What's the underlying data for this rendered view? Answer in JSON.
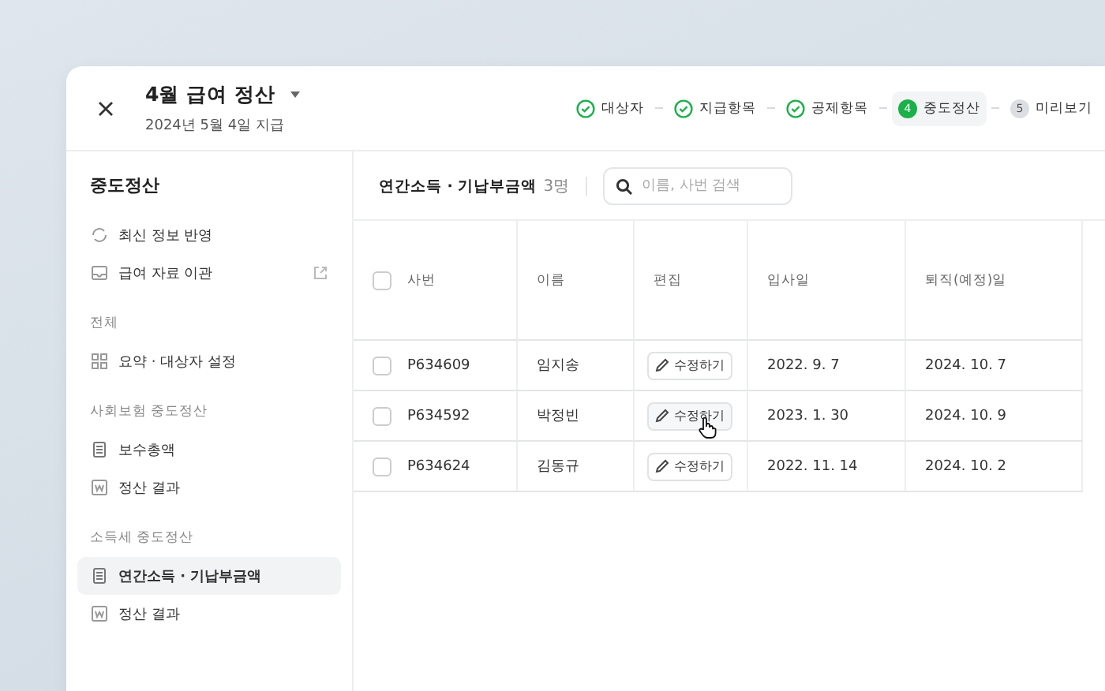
{
  "header": {
    "title": "4월 급여 정산",
    "subtitle": "2024년 5월 4일 지급"
  },
  "steps": [
    {
      "label": "대상자",
      "done": true,
      "selected": false
    },
    {
      "label": "지급항목",
      "done": true,
      "selected": false
    },
    {
      "label": "공제항목",
      "done": true,
      "selected": false
    },
    {
      "label": "중도정산",
      "done": false,
      "selected": true,
      "number": "4"
    },
    {
      "label": "미리보기",
      "done": false,
      "selected": false,
      "number": "5"
    }
  ],
  "sidebar": {
    "title": "중도정산",
    "sections": [
      {
        "items": [
          {
            "label": "최신 정보 반영",
            "kind": "refresh",
            "selected": false,
            "external": false
          },
          {
            "label": "급여 자료 이관",
            "kind": "inbox",
            "selected": false,
            "external": true
          }
        ]
      },
      {
        "heading": "전체",
        "items": [
          {
            "label": "요약 · 대상자 설정",
            "kind": "grid",
            "selected": false,
            "external": false
          }
        ]
      },
      {
        "heading": "사회보험 중도정산",
        "items": [
          {
            "label": "보수총액",
            "kind": "doc",
            "selected": false,
            "external": false
          },
          {
            "label": "정산 결과",
            "kind": "w",
            "selected": false,
            "external": false
          }
        ]
      },
      {
        "heading": "소득세 중도정산",
        "items": [
          {
            "label": "연간소득 · 기납부금액",
            "kind": "doc",
            "selected": true,
            "external": false
          },
          {
            "label": "정산 결과",
            "kind": "w",
            "selected": false,
            "external": false
          }
        ]
      }
    ]
  },
  "content": {
    "title": "연간소득 · 기납부금액",
    "count": "3명",
    "search": {
      "placeholder": "이름, 사번 검색"
    }
  },
  "table": {
    "all_checked": false,
    "columns": [
      "사번",
      "이름",
      "편집",
      "입사일",
      "퇴직(예정)일"
    ],
    "rows": [
      {
        "checked": false,
        "id": "P634609",
        "name": "임지송",
        "edit": "수정하기",
        "hovered": false,
        "joined": "2022. 9. 7",
        "left": "2024. 10. 7"
      },
      {
        "checked": false,
        "id": "P634592",
        "name": "박정빈",
        "edit": "수정하기",
        "hovered": true,
        "joined": "2023. 1. 30",
        "left": "2024. 10. 9"
      },
      {
        "checked": false,
        "id": "P634624",
        "name": "김동규",
        "edit": "수정하기",
        "hovered": false,
        "joined": "2022. 11. 14",
        "left": "2024. 10. 2"
      }
    ]
  }
}
